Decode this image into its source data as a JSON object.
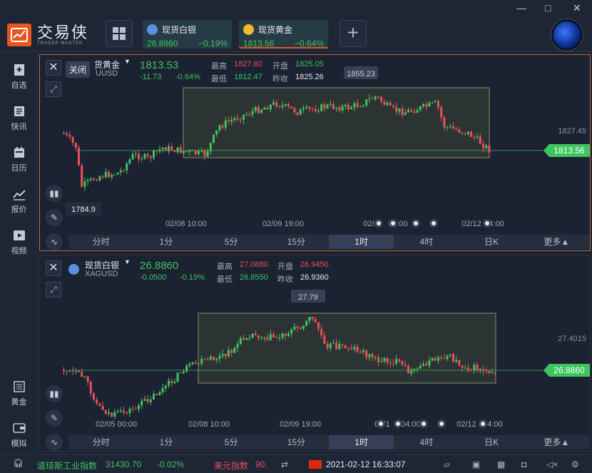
{
  "app": {
    "logo_cn": "交易侠",
    "logo_en": "TRADER MASTER"
  },
  "tabs": [
    {
      "name": "现货白银",
      "price": "26.8860",
      "change": "−0.19%",
      "coin_color": "#5b8fe0"
    },
    {
      "name": "现货黄金",
      "price": "1813.56",
      "change": "−0.64%",
      "coin_color": "#f0b830"
    }
  ],
  "add_tab_label": "+",
  "window": {
    "minimize": "—",
    "maximize": "□",
    "close": "✕"
  },
  "sidebar": [
    {
      "label": "自选",
      "icon": "bookmark-plus-icon"
    },
    {
      "label": "快讯",
      "icon": "news-icon"
    },
    {
      "label": "日历",
      "icon": "calendar-icon"
    },
    {
      "label": "报价",
      "icon": "quote-chart-icon"
    },
    {
      "label": "视频",
      "icon": "video-icon"
    },
    {
      "label": "黄金",
      "icon": "gold-icon"
    },
    {
      "label": "模拟",
      "icon": "wallet-icon"
    }
  ],
  "gold_panel": {
    "close_tooltip": "关闭",
    "name": "货黄金",
    "code": "UUSD",
    "price": "1813.53",
    "change": "-11.73",
    "change_pct": "-0.64%",
    "high_label": "最高",
    "high": "1827.80",
    "open_label": "开盘",
    "open": "1825.05",
    "low_label": "最低",
    "low": "1812.47",
    "prev_label": "昨收",
    "prev": "1825.26",
    "peak_label": "1855.23",
    "trough_label": "1784.9",
    "right_axis": "1827.45",
    "last_badge": "1813.56",
    "dates": [
      "02/08 10:00",
      "02/09 19:00",
      "02/1",
      "04:00",
      "02/12",
      "4:00"
    ]
  },
  "silver_panel": {
    "name": "现货白银",
    "code": "XAGUSD",
    "price": "26.8860",
    "change": "-0.0500",
    "change_pct": "-0.19%",
    "high_label": "最高",
    "high": "27.0880",
    "open_label": "开盘",
    "open": "26.9450",
    "low_label": "最低",
    "low": "26.8550",
    "prev_label": "昨收",
    "prev": "26.9360",
    "peak_label": "27.79",
    "right_axis": "27.4015",
    "last_badge": "26.8860",
    "dates": [
      "02/05 00:00",
      "02/08 10:00",
      "02/09 19:00",
      "02/1",
      "04:00",
      "02/12",
      "4:00"
    ]
  },
  "timeframes": [
    "分时",
    "1分",
    "5分",
    "15分",
    "1时",
    "4时",
    "日K",
    "更多▲"
  ],
  "active_timeframe": "1时",
  "status": {
    "index1_name": "道琼斯工业指数",
    "index1_value": "31430.70",
    "index1_change": "-0.02%",
    "index2_name": "美元指数",
    "index2_value": "90.",
    "datetime": "2021-02-12 16:33:07"
  },
  "colors": {
    "up": "#3fc45e",
    "down": "#e8505b",
    "accent": "#e8561f"
  }
}
